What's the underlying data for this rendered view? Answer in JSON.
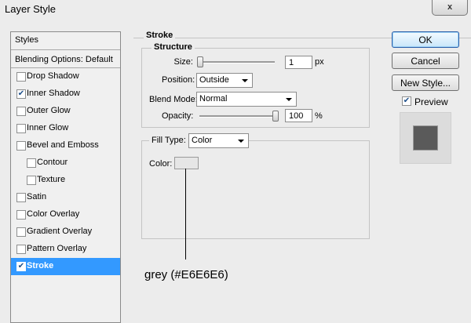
{
  "window": {
    "title": "Layer Style",
    "close_label": "x"
  },
  "sidebar": {
    "header": "Styles",
    "blending": "Blending Options: Default",
    "items": [
      {
        "label": "Drop Shadow",
        "checked": false
      },
      {
        "label": "Inner Shadow",
        "checked": true
      },
      {
        "label": "Outer Glow",
        "checked": false
      },
      {
        "label": "Inner Glow",
        "checked": false
      },
      {
        "label": "Bevel and Emboss",
        "checked": false
      },
      {
        "label": "Contour",
        "checked": false
      },
      {
        "label": "Texture",
        "checked": false
      },
      {
        "label": "Satin",
        "checked": false
      },
      {
        "label": "Color Overlay",
        "checked": false
      },
      {
        "label": "Gradient Overlay",
        "checked": false
      },
      {
        "label": "Pattern Overlay",
        "checked": false
      },
      {
        "label": "Stroke",
        "checked": true,
        "selected": true
      }
    ]
  },
  "stroke": {
    "section_title": "Stroke",
    "structure_title": "Structure",
    "size_label": "Size:",
    "size_value": "1",
    "size_unit": "px",
    "position_label": "Position:",
    "position_value": "Outside",
    "blend_label": "Blend Mode:",
    "blend_value": "Normal",
    "opacity_label": "Opacity:",
    "opacity_value": "100",
    "opacity_unit": "%",
    "fill_type_label": "Fill Type:",
    "fill_type_value": "Color",
    "color_label": "Color:",
    "color_swatch": "#E6E6E6"
  },
  "annotation": {
    "text": "grey (#E6E6E6)"
  },
  "buttons": {
    "ok": "OK",
    "cancel": "Cancel",
    "new_style": "New Style..."
  },
  "preview": {
    "label": "Preview",
    "checked": true,
    "swatch_color": "#5a5a5a"
  },
  "colors": {
    "selection": "#3399ff",
    "panel_bg": "#ececec"
  }
}
